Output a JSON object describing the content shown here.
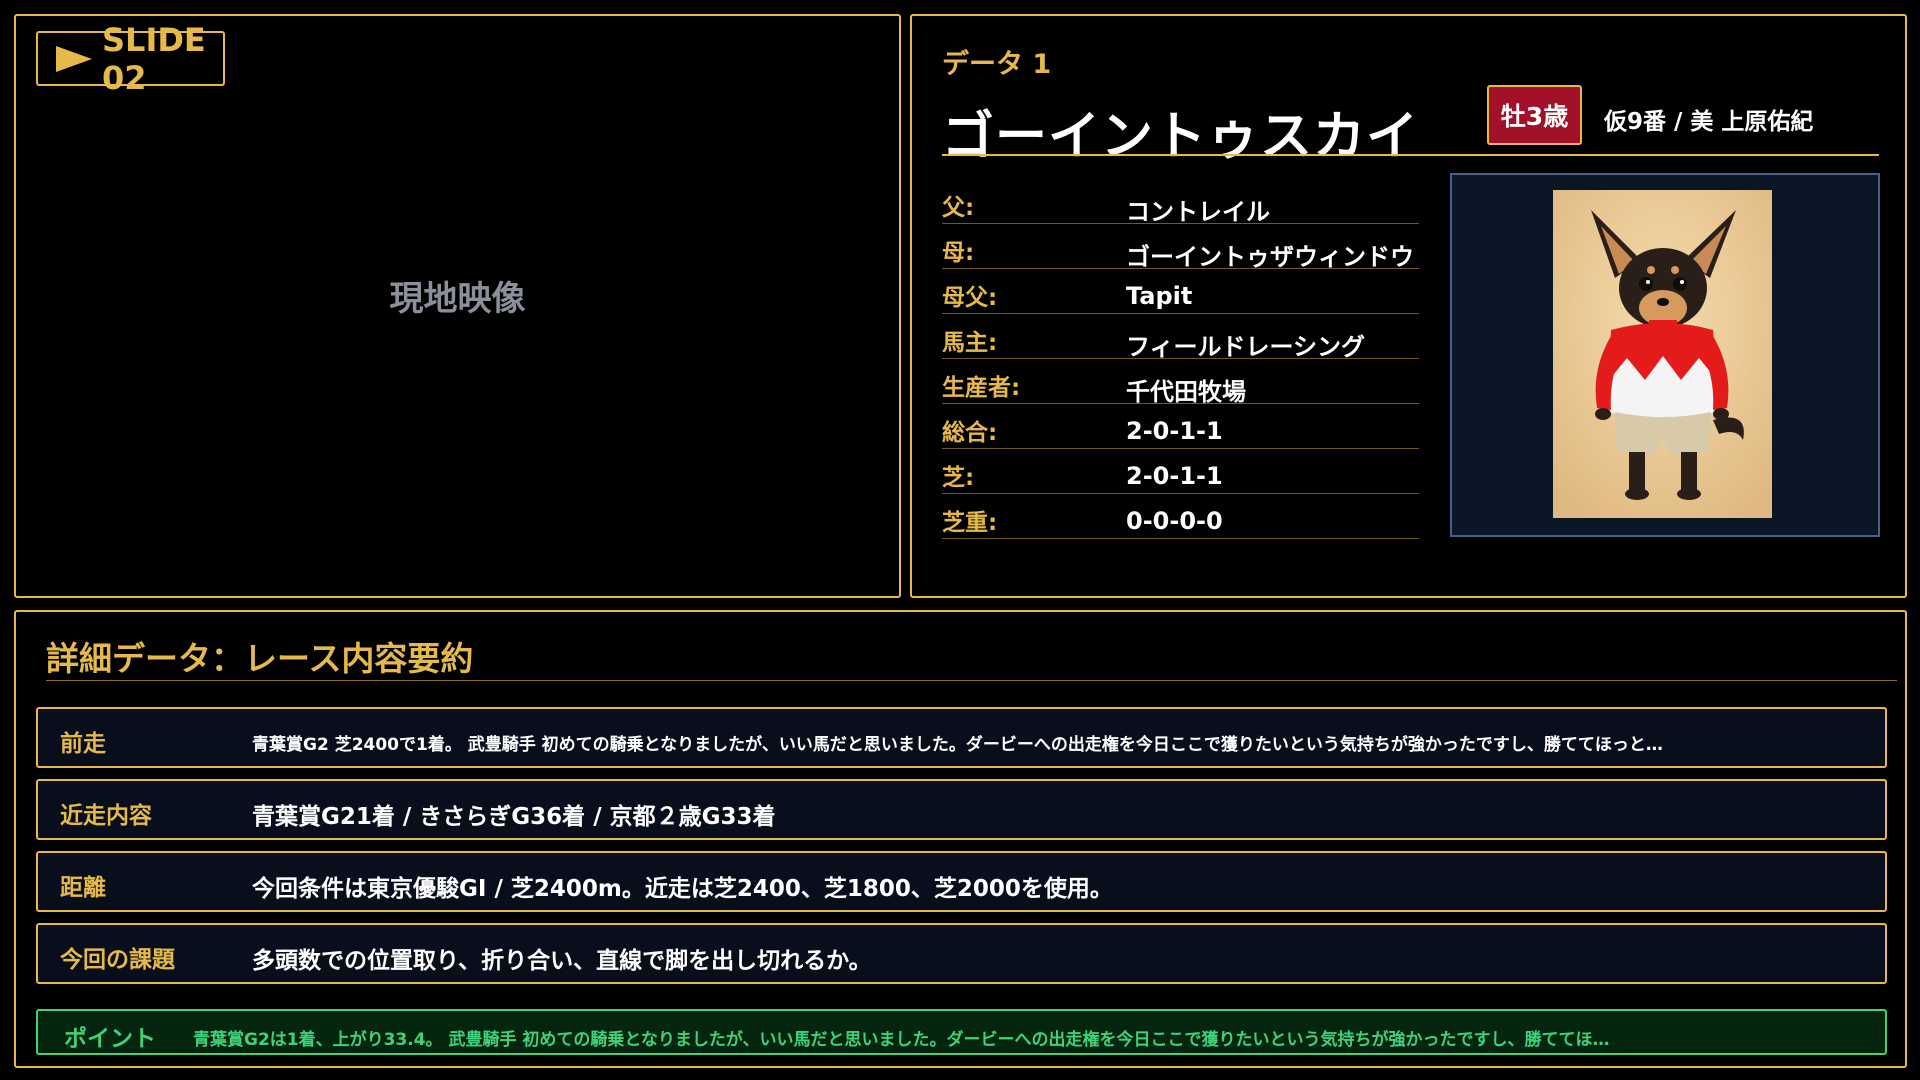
{
  "video_panel": {
    "slide_label": "SLIDE 02",
    "placeholder": "現地映像"
  },
  "data_panel": {
    "data_label": "データ 1",
    "horse_name": "ゴーイントゥスカイ",
    "sex_age": "牡3歳",
    "gate_trainer": "仮9番 / 美 上原佑紀",
    "info": [
      {
        "key": "父:",
        "value": "コントレイル"
      },
      {
        "key": "母:",
        "value": "ゴーイントゥザウィンドウ"
      },
      {
        "key": "母父:",
        "value": "Tapit"
      },
      {
        "key": "馬主:",
        "value": "フィールドレーシング"
      },
      {
        "key": "生産者:",
        "value": "千代田牧場"
      },
      {
        "key": "総合:",
        "value": "2-0-1-1"
      },
      {
        "key": "芝:",
        "value": "2-0-1-1"
      },
      {
        "key": "芝重:",
        "value": "0-0-0-0"
      }
    ]
  },
  "detail": {
    "title": "詳細データ：レース内容要約",
    "rows": [
      {
        "label": "前走",
        "text": "青葉賞G2 芝2400で1着。 武豊騎手 初めての騎乗となりましたが、いい馬だと思いました。ダービーへの出走権を今日ここで獲りたいという気持ちが強かったですし、勝ててほっと…"
      },
      {
        "label": "近走内容",
        "text": "青葉賞G21着 / きさらぎG36着 / 京都２歳G33着"
      },
      {
        "label": "距離",
        "text": "今回条件は東京優駿GI / 芝2400m。近走は芝2400、芝1800、芝2000を使用。"
      },
      {
        "label": "今回の課題",
        "text": "多頭数での位置取り、折り合い、直線で脚を出し切れるか。"
      }
    ],
    "point_label": "ポイント",
    "point_text": "青葉賞G2は1着、上がり33.4。 武豊騎手 初めての騎乗となりましたが、いい馬だと思いました。ダービーへの出走権を今日ここで獲りたいという気持ちが強かったですし、勝ててほ…"
  },
  "colors": {
    "accent": "#e5b94a",
    "badge_red": "#a3102a",
    "point_green": "#3fd27a"
  }
}
